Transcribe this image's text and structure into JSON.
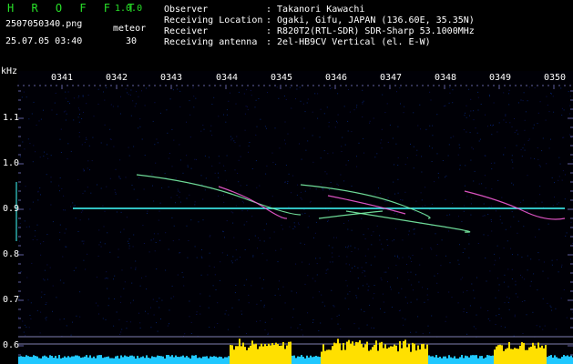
{
  "header": {
    "app_name": "H R O F F T",
    "version": "1.0.0",
    "filename": "2507050340.png",
    "timestamp": "25.07.05 03:40",
    "meteor_label": "meteor",
    "meteor_count": "30",
    "info": [
      {
        "label": "Observer",
        "value": ": Takanori Kawachi"
      },
      {
        "label": "Receiving Location",
        "value": ": Ogaki, Gifu, JAPAN (136.60E, 35.35N)"
      },
      {
        "label": "Receiver",
        "value": ": R820T2(RTL-SDR) SDR-Sharp 53.1000MHz"
      },
      {
        "label": "Receiving antenna",
        "value": ": 2el-HB9CV Vertical (el. E-W)"
      }
    ]
  },
  "plot": {
    "y_unit": "kHz",
    "time_labels": [
      "0341",
      "0342",
      "0343",
      "0344",
      "0345",
      "0346",
      "0347",
      "0348",
      "0349",
      "0350"
    ],
    "freq_labels": [
      "1.1",
      "1.0",
      "0.9",
      "0.8",
      "0.7",
      "0.6"
    ]
  },
  "colors": {
    "green": "#28e028",
    "trace": "#40ffff",
    "bar": "#ffe000",
    "base": "#20c8ff"
  }
}
